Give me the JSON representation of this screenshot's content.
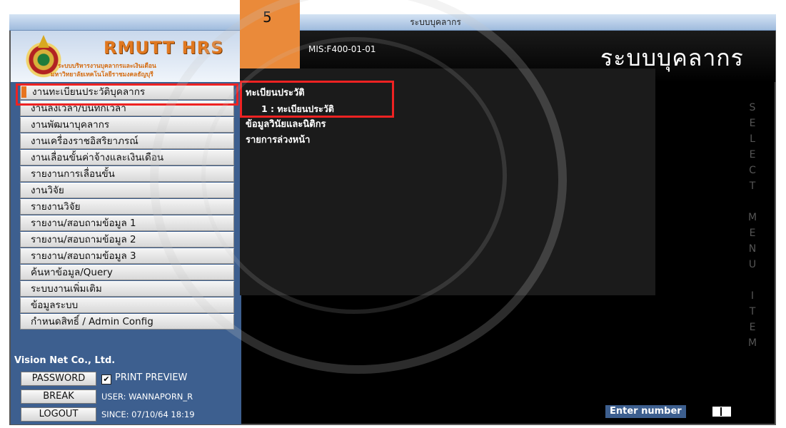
{
  "window_title": "ระบบบุคลากร",
  "logo": {
    "title": "RMUTT HRS",
    "subtitle1": "ระบบบริหารงานบุคลากรและเงินเดือน",
    "subtitle2": "มหาวิทยาลัยเทคโนโลยีราชมงคลธัญบุรี"
  },
  "badge_number": "5",
  "header": {
    "mis_code": "MIS:F400-01-01",
    "title": "ระบบบุคลากร"
  },
  "menu": {
    "items": [
      {
        "label": "งานทะเบียนประวัติบุคลากร",
        "active": true
      },
      {
        "label": "งานลงเวลา/บันทึกเวลา"
      },
      {
        "label": "งานพัฒนาบุคลากร"
      },
      {
        "label": "งานเครื่องราชอิสริยาภรณ์"
      },
      {
        "label": "งานเลื่อนขั้นค่าจ้างและเงินเดือน"
      },
      {
        "label": "รายงานการเลื่อนขั้น"
      },
      {
        "label": "งานวิจัย"
      },
      {
        "label": "รายงานวิจัย"
      },
      {
        "label": "รายงาน/สอบถามข้อมูล 1"
      },
      {
        "label": "รายงาน/สอบถามข้อมูล 2"
      },
      {
        "label": "รายงาน/สอบถามข้อมูล 3"
      },
      {
        "label": "ค้นหาข้อมูล/Query"
      },
      {
        "label": "ระบบงานเพิ่มเติม"
      },
      {
        "label": "ข้อมูลระบบ"
      },
      {
        "label": "กำหนดสิทธิ์ / Admin Config"
      }
    ]
  },
  "submenu": {
    "heading1": "ทะเบียนประวัติ",
    "item1": "1 : ทะเบียนประวัติ",
    "heading2": "ข้อมูลวินัยและนิติกร",
    "heading3": "รายการล่วงหน้า"
  },
  "footer": {
    "company": "Vision Net Co., Ltd.",
    "password_button": "PASSWORD",
    "print_preview": "PRINT PREVIEW",
    "break_button": "BREAK",
    "user": "USER: WANNAPORN_R",
    "logout_button": "LOGOUT",
    "since": "SINCE: 07/10/64 18:19"
  },
  "side_letters": [
    "S",
    "E",
    "L",
    "E",
    "C",
    "T",
    "",
    "M",
    "E",
    "N",
    "U",
    "",
    "I",
    "T",
    "E",
    "M"
  ],
  "enter_number_label": "Enter number",
  "colors": {
    "accent_orange": "#e8741e",
    "highlight_red": "#e22222",
    "sidebar_blue": "#3d5f8f",
    "badge_orange": "#ea8a3a"
  }
}
